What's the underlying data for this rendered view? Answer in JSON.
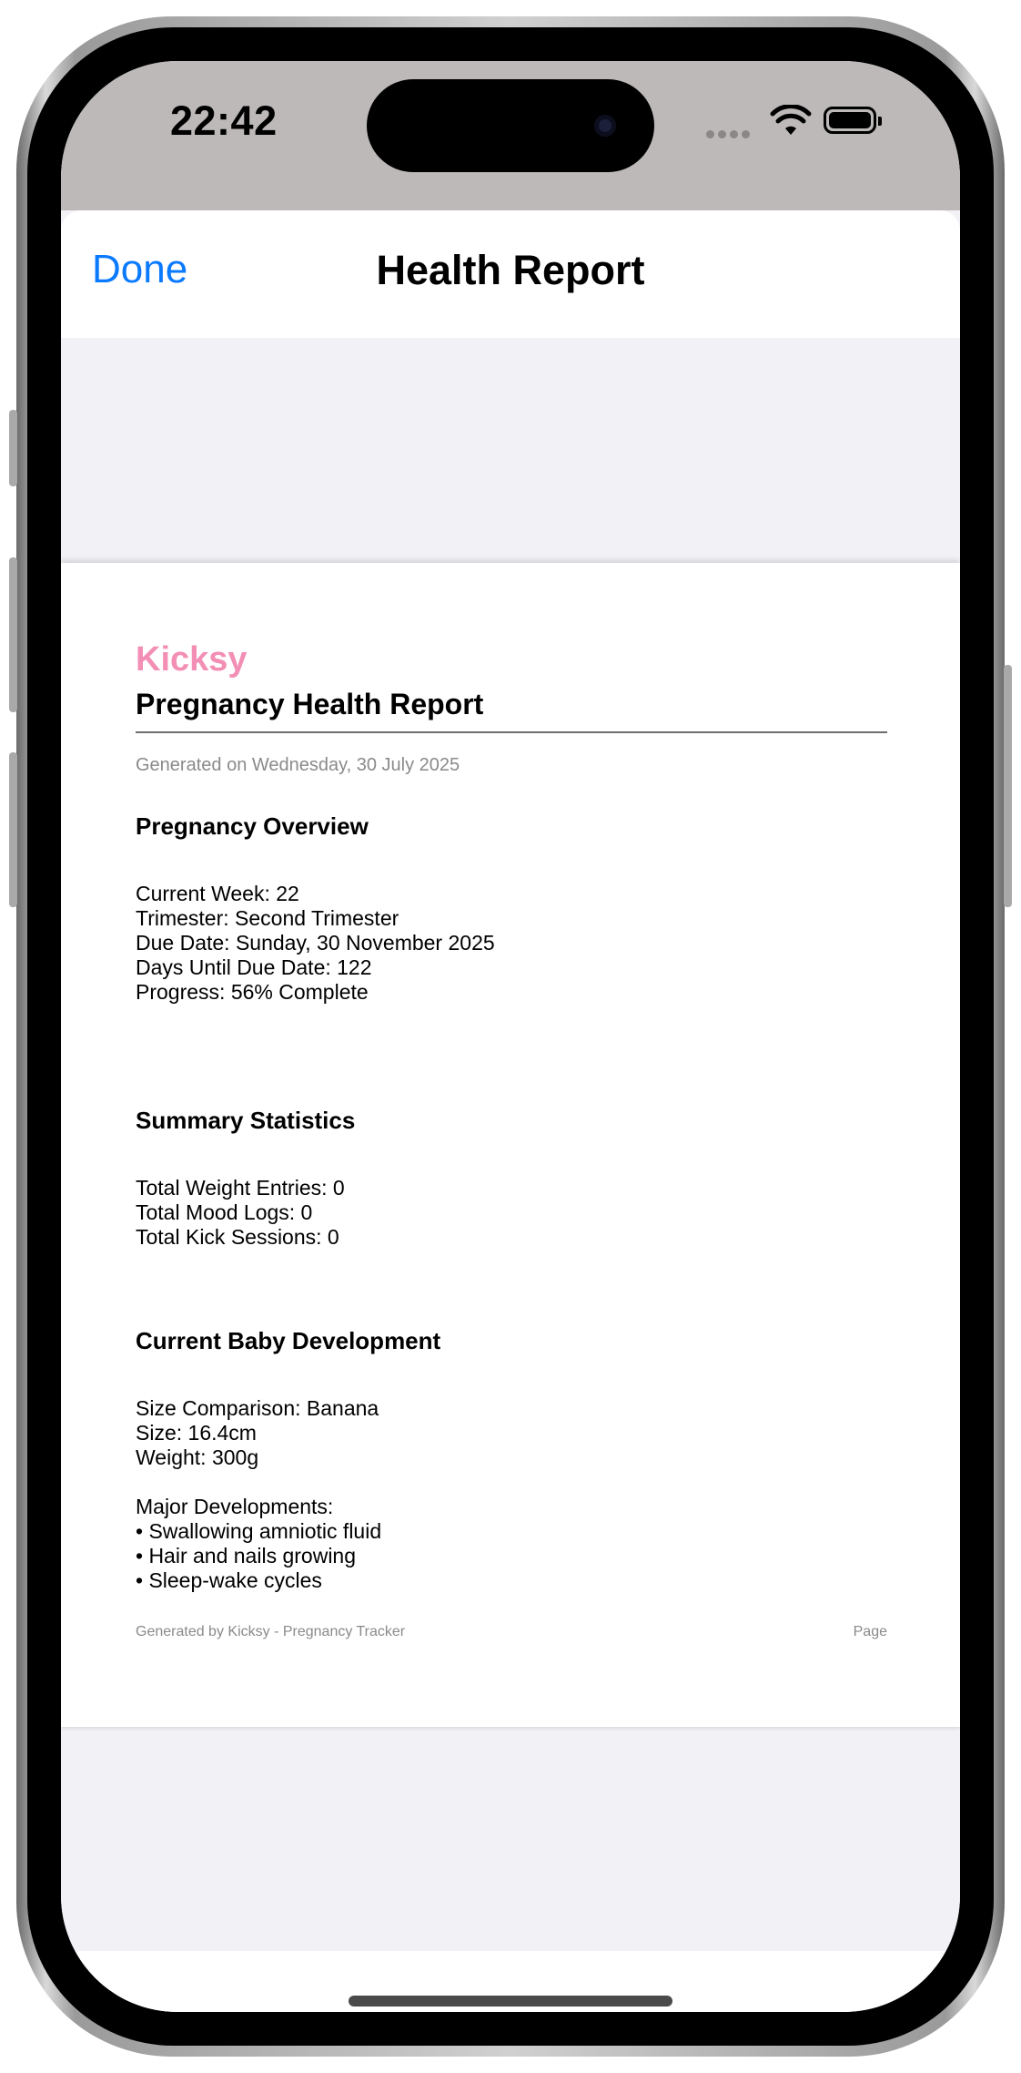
{
  "status_bar": {
    "time": "22:42"
  },
  "navbar": {
    "done_label": "Done",
    "title": "Health Report"
  },
  "report": {
    "brand": "Kicksy",
    "title": "Pregnancy Health Report",
    "generated": "Generated on Wednesday, 30 July 2025",
    "overview": {
      "heading": "Pregnancy Overview",
      "lines": [
        "Current Week: 22",
        "Trimester: Second Trimester",
        "Due Date: Sunday, 30 November 2025",
        "Days Until Due Date: 122",
        "Progress: 56% Complete"
      ]
    },
    "summary": {
      "heading": "Summary Statistics",
      "lines": [
        "Total Weight Entries: 0",
        "Total Mood Logs: 0",
        "Total Kick Sessions: 0"
      ]
    },
    "baby": {
      "heading": "Current Baby Development",
      "lines": [
        "Size Comparison: Banana",
        "Size: 16.4cm",
        "Weight: 300g"
      ],
      "developments_label": "Major Developments:",
      "developments": [
        "• Swallowing amniotic fluid",
        "• Hair and nails growing",
        "• Sleep-wake cycles"
      ]
    },
    "footer_left": "Generated by Kicksy - Pregnancy Tracker",
    "footer_right": "Page"
  },
  "colors": {
    "accent": "#0a7aff",
    "brand": "#f38fb5",
    "sheet_background": "#f1f1f6",
    "status_background": "#bdb9b9"
  },
  "icons": [
    "wifi-icon",
    "battery-icon",
    "cellular-dots-icon",
    "front-camera-icon"
  ]
}
